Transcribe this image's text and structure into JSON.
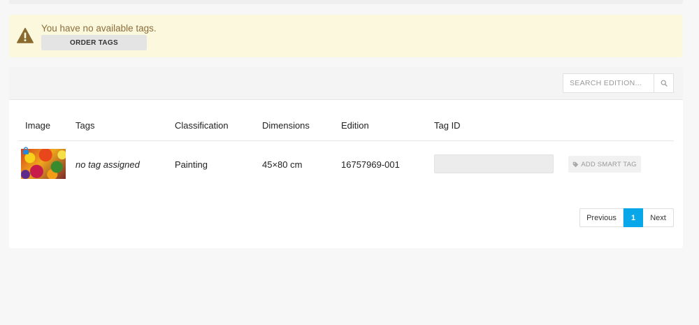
{
  "alert": {
    "message": "You have no available tags.",
    "order_button": "ORDER TAGS"
  },
  "search": {
    "placeholder": "SEARCH EDITION..."
  },
  "table": {
    "columns": [
      "Image",
      "Tags",
      "Classification",
      "Dimensions",
      "Edition",
      "Tag ID"
    ],
    "rows": [
      {
        "tags": "no tag assigned",
        "classification": "Painting",
        "dimensions": "45×80 cm",
        "edition": "16757969-001",
        "tag_id": "",
        "action": "ADD SMART TAG"
      }
    ]
  },
  "pagination": {
    "previous": "Previous",
    "current": "1",
    "next": "Next"
  },
  "colors": {
    "alert_bg": "#fbf8dd",
    "alert_text": "#8a6d3b",
    "accent": "#08a7e9",
    "lock": "#1a8be0"
  },
  "icons": {
    "alert": "warning-triangle-icon",
    "search": "magnifier-icon",
    "lock": "padlock-icon",
    "tag": "tag-icon"
  }
}
